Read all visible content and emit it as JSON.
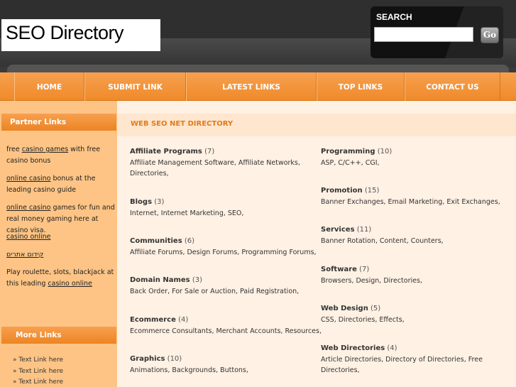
{
  "header": {
    "logo_text": "SEO Directory",
    "search_label": "SEARCH",
    "search_value": "",
    "go_label": "Go"
  },
  "nav": [
    {
      "label": "HOME"
    },
    {
      "label": "SUBMIT LINK"
    },
    {
      "label": "LATEST LINKS"
    },
    {
      "label": "TOP LINKS"
    },
    {
      "label": "CONTACT US"
    }
  ],
  "sidebar": {
    "partner_heading": "Partner Links",
    "entries": [
      {
        "before": "free ",
        "link": "casino games",
        "after": " with free casino bonus"
      },
      {
        "before": "",
        "link": "online casino",
        "after": " bonus at the leading casino guide"
      },
      {
        "before": "",
        "link": "online casino",
        "after": " games for fun and real money gaming here at casino visa."
      },
      {
        "before": "",
        "link": "casino online",
        "after": ""
      },
      {
        "before": "",
        "link": "קידום אתרים",
        "after": ""
      },
      {
        "before": "Play roulette, slots, blackjack at this leading ",
        "link": "casino online",
        "after": ""
      }
    ],
    "more_heading": "More Links",
    "more_links": [
      "» Text Link here",
      "» Text Link here",
      "» Text Link here"
    ]
  },
  "main": {
    "title": "WEB SEO NET DIRECTORY",
    "categories_left": [
      {
        "name": "Affiliate Programs",
        "count": "(7)",
        "subs": "Affiliate Management Software, Affiliate Networks, Directories,"
      },
      {
        "name": "Blogs",
        "count": "(3)",
        "subs": "Internet, Internet Marketing, SEO,"
      },
      {
        "name": "Communities",
        "count": "(6)",
        "subs": "Affiliate Forums, Design Forums, Programming Forums,"
      },
      {
        "name": "Domain Names",
        "count": "(3)",
        "subs": "Back Order, For Sale or Auction, Paid Registration,"
      },
      {
        "name": "Ecommerce",
        "count": "(4)",
        "subs": "Ecommerce Consultants, Merchant Accounts, Resources,"
      },
      {
        "name": "Graphics",
        "count": "(10)",
        "subs": "Animations, Backgrounds, Buttons,"
      }
    ],
    "categories_right": [
      {
        "name": "Programming",
        "count": "(10)",
        "subs": "ASP, C/C++, CGI,"
      },
      {
        "name": "Promotion",
        "count": "(15)",
        "subs": "Banner Exchanges, Email Marketing, Exit Exchanges,"
      },
      {
        "name": "Services",
        "count": "(11)",
        "subs": "Banner Rotation, Content, Counters,"
      },
      {
        "name": "Software",
        "count": "(7)",
        "subs": "Browsers, Design, Directories,"
      },
      {
        "name": "Web Design",
        "count": "(5)",
        "subs": "CSS, Directories, Effects,"
      },
      {
        "name": "Web Directories",
        "count": "(4)",
        "subs": "Article Directories, Directory of Directories, Free Directories,"
      }
    ]
  }
}
